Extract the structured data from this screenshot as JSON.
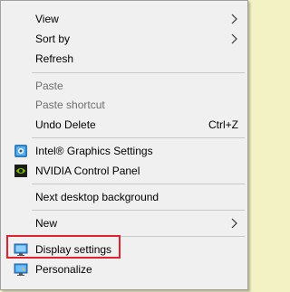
{
  "menu": {
    "view": "View",
    "sort_by": "Sort by",
    "refresh": "Refresh",
    "paste": "Paste",
    "paste_shortcut": "Paste shortcut",
    "undo_delete": "Undo Delete",
    "undo_delete_shortcut": "Ctrl+Z",
    "intel": "Intel® Graphics Settings",
    "nvidia": "NVIDIA Control Panel",
    "next_bg": "Next desktop background",
    "new": "New",
    "display_settings": "Display settings",
    "personalize": "Personalize"
  },
  "colors": {
    "highlight_border": "#e0212e",
    "desktop_bg": "#f2f2c5",
    "menu_bg": "#f0f0f0"
  }
}
